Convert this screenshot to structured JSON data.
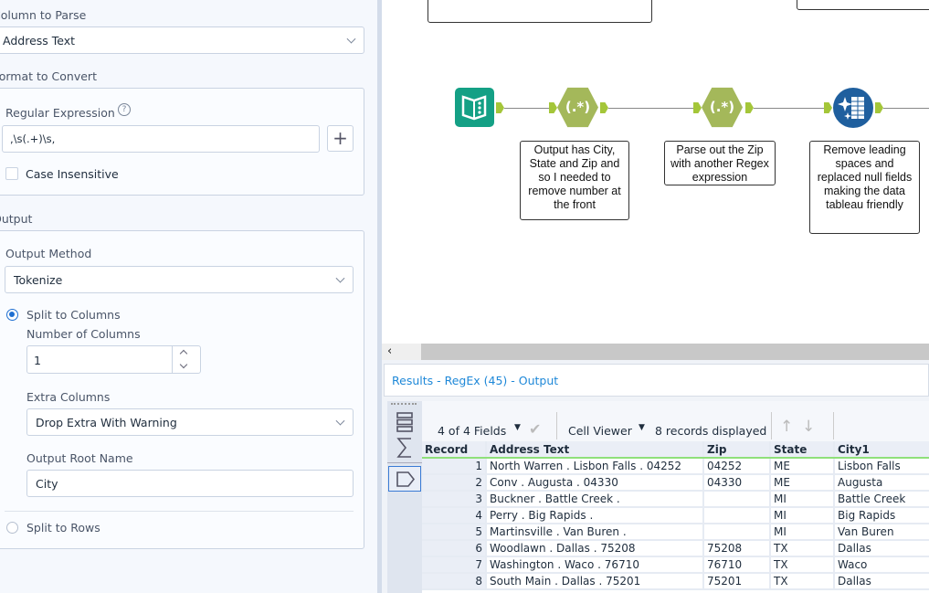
{
  "config": {
    "column_to_parse_label": "Column to Parse",
    "column_to_parse_value": "Address Text",
    "format_label": "Format to Convert",
    "regex_label": "Regular Expression",
    "regex_value": ",\\s(.+)\\s,",
    "case_insensitive_label": "Case Insensitive",
    "case_insensitive": false,
    "output_label": "Output",
    "output_method_label": "Output Method",
    "output_method_value": "Tokenize",
    "split_columns_label": "Split to Columns",
    "num_columns_label": "Number of Columns",
    "num_columns_value": "1",
    "extra_columns_label": "Extra Columns",
    "extra_columns_value": "Drop Extra With Warning",
    "root_name_label": "Output Root Name",
    "root_name_value": "City",
    "split_rows_label": "Split to Rows",
    "selected_mode": "Split to Columns"
  },
  "canvas": {
    "tool_labels": [
      "(.*)",
      "(.*)"
    ],
    "comments": [
      "Output has City, State and Zip and so I needed to remove number at the front",
      "Parse out the Zip with another Regex expression",
      "Remove leading spaces and replaced null fields making the data tableau friendly"
    ],
    "colors": {
      "regex": "#a4b85a",
      "anchor": "#a4c639",
      "book": "#14a085",
      "cleanse": "#1f5f9e"
    }
  },
  "results": {
    "title": "Results - RegEx (45) - Output",
    "fields": "4 of 4 Fields",
    "cell_viewer": "Cell Viewer",
    "records": "8 records displayed",
    "columns": [
      "Record",
      "Address Text",
      "Zip",
      "State",
      "City1"
    ],
    "rows": [
      [
        "1",
        "North Warren . Lisbon Falls . 04252",
        "04252",
        "ME",
        "Lisbon Falls"
      ],
      [
        "2",
        "Conv . Augusta . 04330",
        "04330",
        "ME",
        "Augusta"
      ],
      [
        "3",
        "Buckner . Battle Creek .",
        "",
        "MI",
        "Battle Creek"
      ],
      [
        "4",
        "Perry . Big Rapids .",
        "",
        "MI",
        "Big Rapids"
      ],
      [
        "5",
        "Martinsville . Van Buren .",
        "",
        "MI",
        "Van Buren"
      ],
      [
        "6",
        "Woodlawn . Dallas . 75208",
        "75208",
        "TX",
        "Dallas"
      ],
      [
        "7",
        "Washington . Waco . 76710",
        "76710",
        "TX",
        "Waco"
      ],
      [
        "8",
        "South Main . Dallas . 75201",
        "75201",
        "TX",
        "Dallas"
      ]
    ]
  }
}
